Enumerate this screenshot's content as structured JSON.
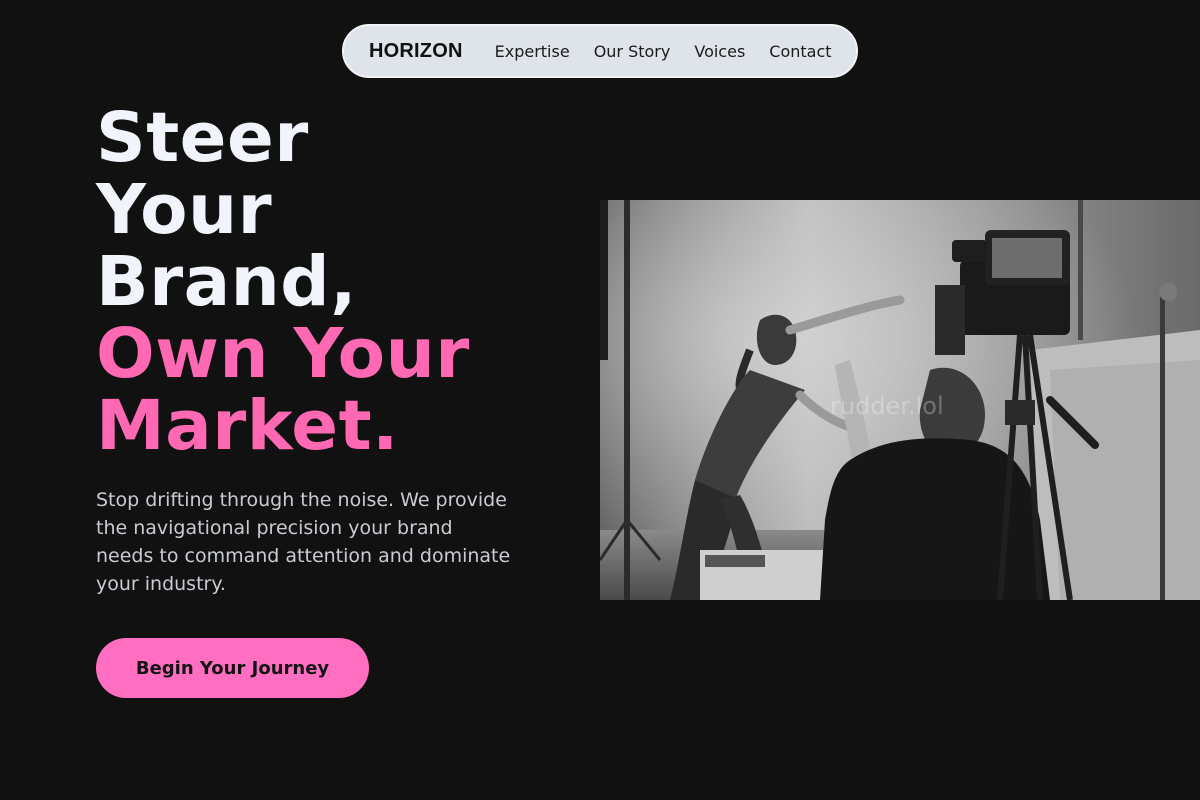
{
  "nav": {
    "brand": "HORIZON",
    "links": [
      "Expertise",
      "Our Story",
      "Voices",
      "Contact"
    ]
  },
  "hero": {
    "headline_lines_light": [
      "Steer",
      "Your",
      "Brand,"
    ],
    "headline_lines_accent": [
      "Own Your",
      "Market."
    ],
    "subtext": "Stop drifting through the noise. We provide the navigational precision your brand needs to command attention and dominate your industry.",
    "cta_label": "Begin Your Journey",
    "image_watermark": "rudder.lol"
  },
  "colors": {
    "background": "#111112",
    "accent": "#ff69b4",
    "cta_background": "#ff6ec0",
    "nav_background": "#dfe3ea",
    "headline_light": "#f1f5fb",
    "subtext": "#c8ccd2"
  }
}
